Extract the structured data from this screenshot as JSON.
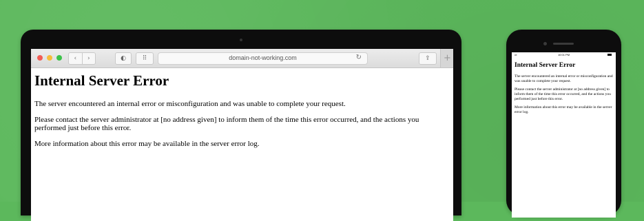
{
  "browser": {
    "url": "domain-not-working.com",
    "back_glyph": "‹",
    "forward_glyph": "›",
    "shield_glyph": "◐",
    "grid_glyph": "⠿",
    "reload_glyph": "↻",
    "share_glyph": "⇪",
    "new_tab_glyph": "+"
  },
  "page": {
    "title": "Internal Server Error",
    "paragraphs": [
      "The server encountered an internal error or misconfiguration and was unable to complete your request.",
      "Please contact the server administrator at [no address given] to inform them of the time this error occurred, and the actions you performed just before this error.",
      "More information about this error may be available in the server error log."
    ]
  },
  "phone": {
    "time": "10:01 PM",
    "signal": "•ıl",
    "title": "Internal Server Error",
    "paragraphs": [
      "The server encountered an internal error or misconfiguration and was unable to complete your request.",
      "Please contact the server administrator at [no address given] to inform them of the time this error occurred, and the actions you performed just before this error.",
      "More information about this error may be available in the server error log."
    ]
  },
  "colors": {
    "background": "#5cb85c",
    "device_bezel": "#0d0d0d",
    "traffic_red": "#f25c54",
    "traffic_yellow": "#f6bd3b",
    "traffic_green": "#3cc24a"
  }
}
